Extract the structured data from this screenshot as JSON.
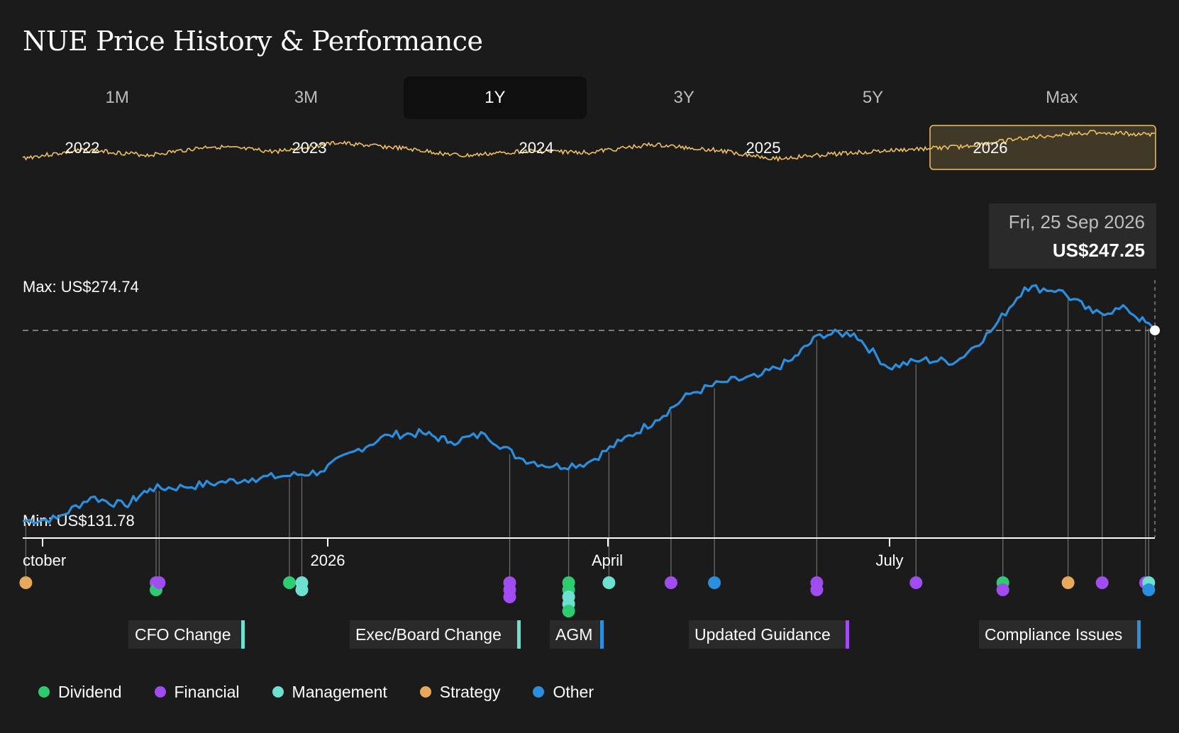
{
  "title": "NUE Price History & Performance",
  "ranges": [
    {
      "label": "1M",
      "active": false
    },
    {
      "label": "3M",
      "active": false
    },
    {
      "label": "1Y",
      "active": true
    },
    {
      "label": "3Y",
      "active": false
    },
    {
      "label": "5Y",
      "active": false
    },
    {
      "label": "Max",
      "active": false
    }
  ],
  "navigator": {
    "year_labels": [
      "2022",
      "2023",
      "2024",
      "2025",
      "2026"
    ],
    "line_color": "#f0c060",
    "selection_color": "#f0c060"
  },
  "tooltip": {
    "date": "Fri, 25 Sep 2026",
    "price": "US$247.25"
  },
  "chart_data": {
    "type": "line",
    "series": [
      {
        "color": "#2b8fe0",
        "x": [
          "2025-09-25",
          "2025-10-06",
          "2025-10-17",
          "2025-10-28",
          "2025-11-05",
          "2025-11-16",
          "2025-11-27",
          "2025-12-08",
          "2025-12-19",
          "2025-12-30",
          "2026-01-10",
          "2026-01-21",
          "2026-02-01",
          "2026-02-10",
          "2026-02-21",
          "2026-03-04",
          "2026-03-15",
          "2026-03-26",
          "2026-04-06",
          "2026-04-17",
          "2026-04-28",
          "2026-05-09",
          "2026-05-20",
          "2026-05-31",
          "2026-06-09",
          "2026-06-20",
          "2026-07-01",
          "2026-07-12",
          "2026-07-23",
          "2026-08-03",
          "2026-08-14",
          "2026-08-25",
          "2026-09-05",
          "2026-09-16",
          "2026-09-25"
        ],
        "y": [
          135.5,
          137,
          149.5,
          144.5,
          154.5,
          155.5,
          158,
          160.5,
          162,
          164.5,
          176.5,
          186,
          187,
          182,
          186.5,
          172.5,
          167.5,
          169.5,
          182.5,
          194.5,
          210,
          217,
          220,
          230,
          245,
          245.5,
          225.5,
          230,
          229,
          246.5,
          272.5,
          271,
          257.5,
          260,
          247.25
        ]
      }
    ],
    "y_max_label": "Max: US$274.74",
    "y_min_label": "Min: US$131.78",
    "y_max": 274.74,
    "y_min": 131.78,
    "x_tick_labels": [
      "ctober",
      "2026",
      "April",
      "July"
    ],
    "reference_line_value": 247.25,
    "events": [
      {
        "date": "2025-09-26",
        "categories": [
          "Strategy"
        ]
      },
      {
        "date": "2025-11-07",
        "categories": [
          "Financial",
          "Dividend"
        ]
      },
      {
        "date": "2025-11-08",
        "categories": [
          "Financial"
        ]
      },
      {
        "date": "2025-12-20",
        "categories": [
          "Dividend"
        ]
      },
      {
        "date": "2025-12-24",
        "categories": [
          "Management",
          "Management"
        ]
      },
      {
        "date": "2026-02-29",
        "categories": [
          "Financial",
          "Financial",
          "Financial"
        ]
      },
      {
        "date": "2026-03-20",
        "categories": [
          "Dividend",
          "Dividend",
          "Management",
          "Management",
          "Dividend"
        ]
      },
      {
        "date": "2026-04-02",
        "categories": [
          "Management"
        ]
      },
      {
        "date": "2026-04-22",
        "categories": [
          "Financial"
        ]
      },
      {
        "date": "2026-05-06",
        "categories": [
          "Other"
        ]
      },
      {
        "date": "2026-06-08",
        "categories": [
          "Financial",
          "Financial"
        ]
      },
      {
        "date": "2026-07-10",
        "categories": [
          "Financial"
        ]
      },
      {
        "date": "2026-08-07",
        "categories": [
          "Dividend",
          "Financial"
        ]
      },
      {
        "date": "2026-08-28",
        "categories": [
          "Strategy"
        ]
      },
      {
        "date": "2026-09-08",
        "categories": [
          "Financial"
        ]
      },
      {
        "date": "2026-09-22",
        "categories": [
          "Financial"
        ]
      },
      {
        "date": "2026-09-23",
        "categories": [
          "Management",
          "Other"
        ]
      }
    ],
    "annotations": [
      {
        "label": "CFO Change",
        "category": "Management"
      },
      {
        "label": "Exec/Board Change",
        "category": "Management"
      },
      {
        "label": "AGM",
        "category": "Other"
      },
      {
        "label": "Updated Guidance",
        "category": "Financial"
      },
      {
        "label": "Compliance Issues",
        "category": "Other"
      }
    ],
    "legend": [
      {
        "name": "Dividend",
        "color": "#2ecc71"
      },
      {
        "name": "Financial",
        "color": "#a04cf0"
      },
      {
        "name": "Management",
        "color": "#6ee0cf"
      },
      {
        "name": "Strategy",
        "color": "#e8a95b"
      },
      {
        "name": "Other",
        "color": "#2b8fe0"
      }
    ],
    "legend_position": "bottom-left",
    "grid": false
  }
}
